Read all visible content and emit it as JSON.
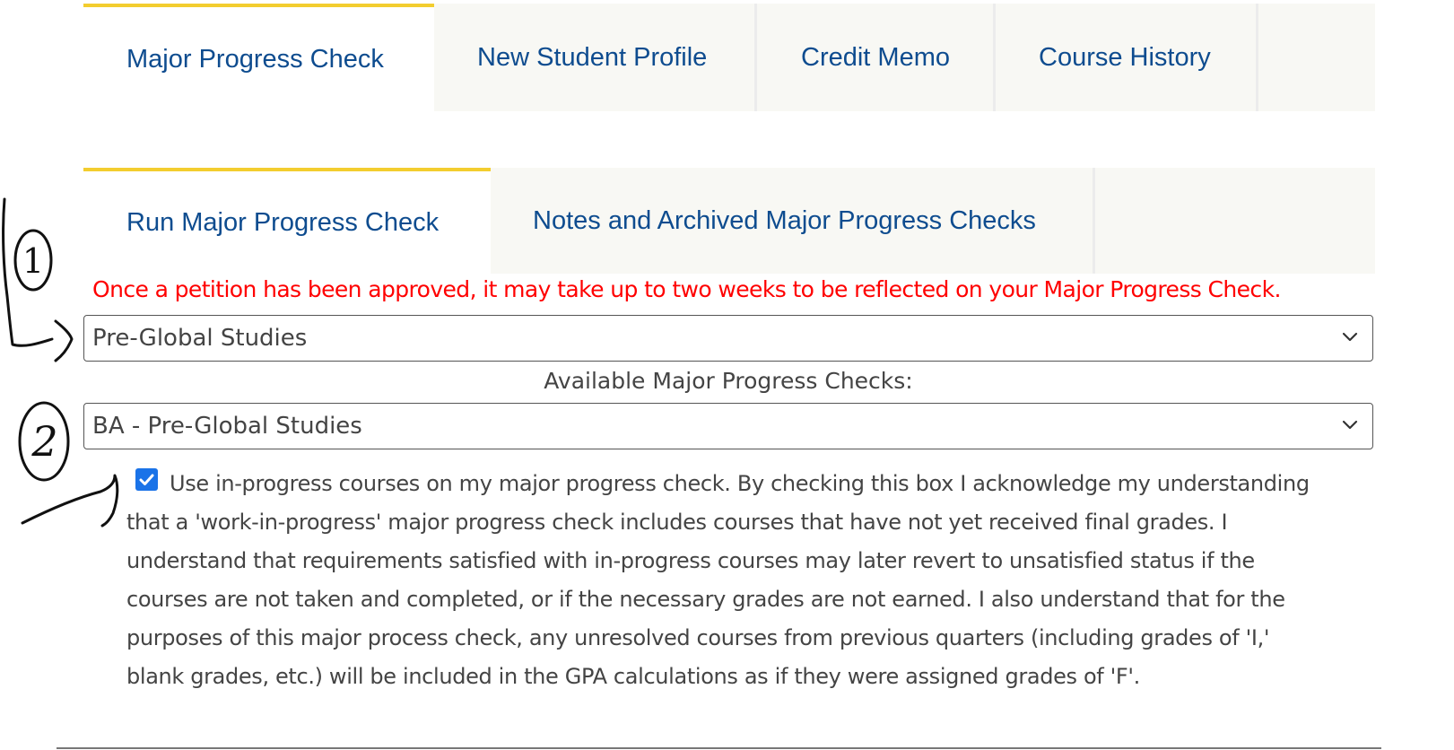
{
  "top_tabs": [
    {
      "label": "Major Progress Check",
      "active": true
    },
    {
      "label": "New Student Profile",
      "active": false
    },
    {
      "label": "Credit Memo",
      "active": false
    },
    {
      "label": "Course History",
      "active": false
    }
  ],
  "sub_tabs": [
    {
      "label": "Run Major Progress Check",
      "active": true
    },
    {
      "label": "Notes and Archived Major Progress Checks",
      "active": false
    }
  ],
  "warning": "Once a petition has been approved, it may take up to two weeks to be reflected on your Major Progress Check.",
  "major_select": {
    "value": "Pre-Global Studies"
  },
  "available_label": "Available Major Progress Checks:",
  "check_select": {
    "value": "BA - Pre-Global Studies"
  },
  "in_progress_checkbox": {
    "checked": true
  },
  "acknowledgement": "Use in-progress courses on my major progress check. By checking this box I acknowledge my understanding that a 'work-in-progress' major progress check includes courses that have not yet received final grades. I understand that requirements satisfied with in-progress courses may later revert to unsatisfied status if the courses are not taken and completed, or if the necessary grades are not earned. I also understand that for the purposes of this major process check, any unresolved courses from previous quarters (including grades of 'I,' blank grades, etc.) will be included in the GPA calculations as if they were assigned grades of 'F'.",
  "annotation_marks": {
    "mark_1": "1",
    "mark_2": "2"
  },
  "colors": {
    "accent_border": "#f3cd2f",
    "tab_text": "#0e4c8f",
    "warning": "#ff0000",
    "checkbox": "#1a73e8"
  },
  "icons": {
    "dropdown": "chevron-down-icon",
    "checkbox": "check-icon"
  }
}
